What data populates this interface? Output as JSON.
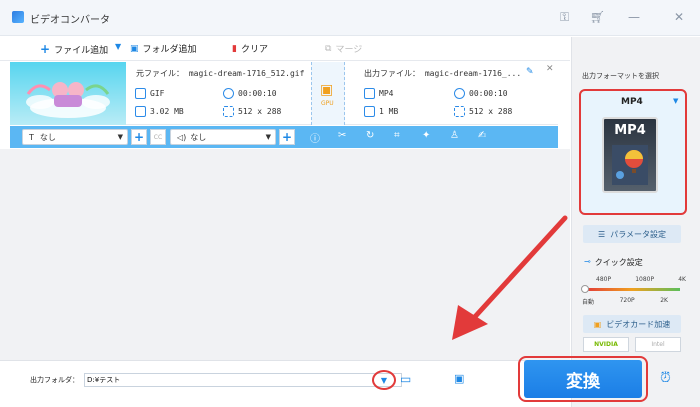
{
  "title_bar": {
    "title": "ビデオコンバータ"
  },
  "toolbar": {
    "add_file": "ファイル追加",
    "add_folder": "フォルダ追加",
    "clear": "クリア",
    "merge": "マージ"
  },
  "source": {
    "label": "元ファイル：",
    "filename": "magic-dream-1716_512.gif",
    "format": "GIF",
    "duration": "00:00:10",
    "size": "3.02 MB",
    "resolution": "512 x 288"
  },
  "output": {
    "label": "出力ファイル：",
    "filename": "magic-dream-1716_...",
    "format": "MP4",
    "duration": "00:00:10",
    "size": "1 MB",
    "resolution": "512 x 288"
  },
  "gpu_label": "GPU",
  "edit_bar": {
    "subtitle_value": "なし",
    "audio_value": "なし",
    "cc": "CC"
  },
  "right_panel": {
    "output_format_label": "出力フォーマットを選択",
    "selected_format": "MP4",
    "format_icon_text": "MP4",
    "param_settings": "パラメータ設定",
    "quick_settings": "クイック設定",
    "slider_top": [
      "480P",
      "1080P",
      "4K"
    ],
    "slider_bottom": [
      "自動",
      "720P",
      "2K"
    ],
    "gpu_accel": "ビデオカード加速",
    "nvidia": "NVIDIA",
    "intel": "Intel"
  },
  "bottom": {
    "output_folder_label": "出力フォルダ：",
    "folder_path": "D:¥テスト",
    "convert_label": "変換"
  }
}
